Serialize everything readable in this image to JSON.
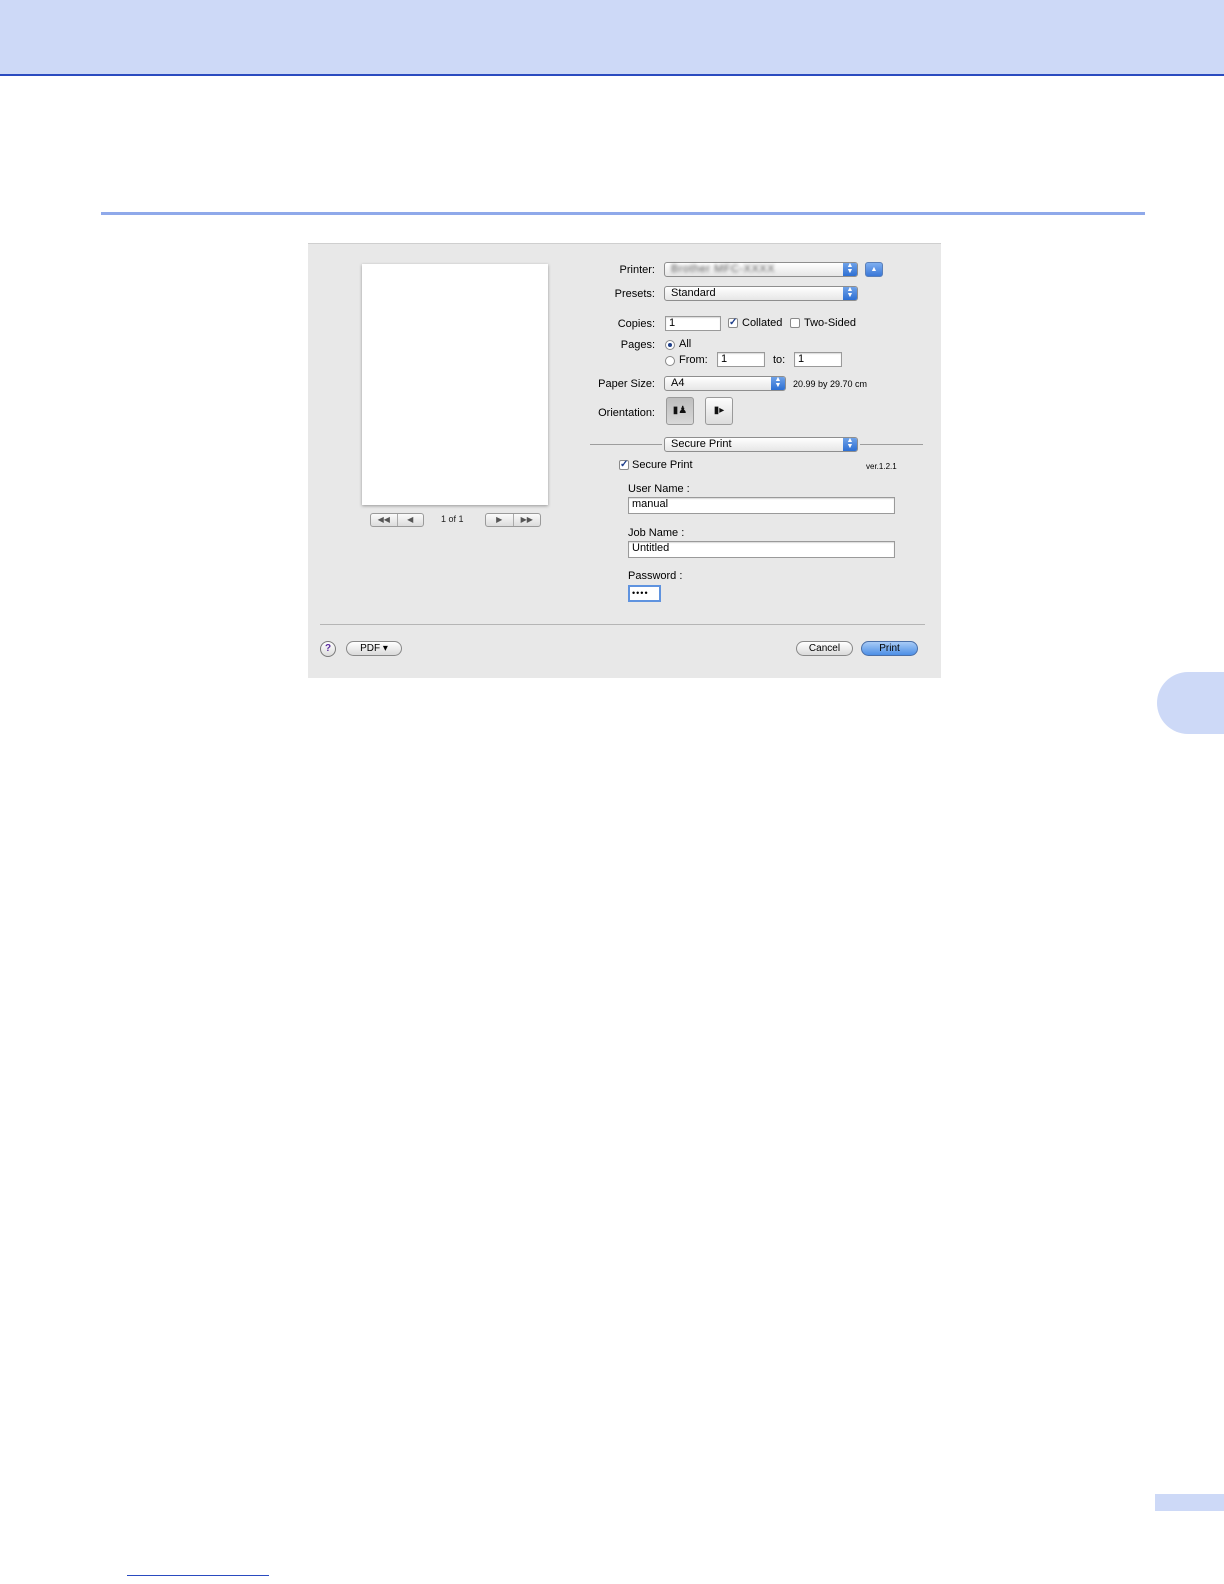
{
  "dialog": {
    "printer": {
      "label": "Printer:",
      "value": "Brother MFC-XXXX",
      "eject_icon": "triangle-up-icon"
    },
    "presets": {
      "label": "Presets:",
      "value": "Standard"
    },
    "copies": {
      "label": "Copies:",
      "value": "1",
      "collated_label": "Collated",
      "collated_checked": true,
      "two_sided_label": "Two-Sided",
      "two_sided_checked": false
    },
    "pages": {
      "label": "Pages:",
      "all_label": "All",
      "from_label": "From:",
      "from_value": "1",
      "to_label": "to:",
      "to_value": "1",
      "selected": "All"
    },
    "paper_size": {
      "label": "Paper Size:",
      "value": "A4",
      "dimensions": "20.99 by 29.70 cm"
    },
    "orientation": {
      "label": "Orientation:",
      "portrait_icon": "portrait-orientation-icon",
      "landscape_icon": "landscape-orientation-icon",
      "selected": "portrait"
    },
    "panel_popup": {
      "value": "Secure Print"
    },
    "secure_print": {
      "checkbox_label": "Secure Print",
      "checked": true,
      "version": "ver.1.2.1",
      "user_name_label": "User Name :",
      "user_name_value": "manual",
      "job_name_label": "Job Name :",
      "job_name_value": "Untitled",
      "password_label": "Password :",
      "password_value": "••••"
    },
    "preview": {
      "page_counter": "1 of 1",
      "first_glyph": "◀◀",
      "prev_glyph": "◀",
      "next_glyph": "▶",
      "last_glyph": "▶▶"
    },
    "footer": {
      "help_glyph": "?",
      "pdf_label": "PDF ▾",
      "cancel_label": "Cancel",
      "print_label": "Print"
    }
  },
  "colors": {
    "header_band": "#cdd9f7",
    "header_rule": "#2a4bc0",
    "section_rule": "#8fa9ea",
    "accent_blue": "#4c8fe6"
  }
}
